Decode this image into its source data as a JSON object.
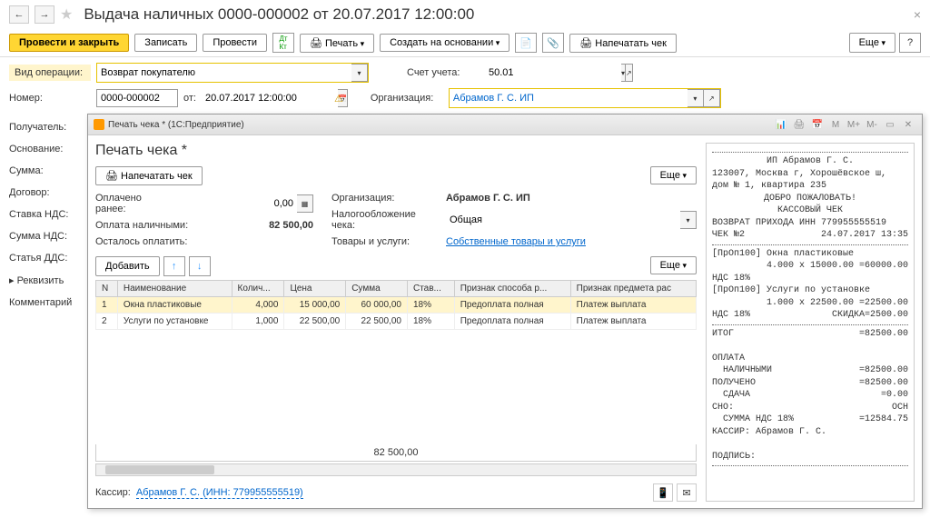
{
  "title": "Выдача наличных 0000-000002 от 20.07.2017 12:00:00",
  "toolbar": {
    "conduct_close": "Провести и закрыть",
    "save": "Записать",
    "conduct": "Провести",
    "print": "Печать",
    "create_based": "Создать на основании",
    "print_check": "Напечатать чек",
    "more": "Еще"
  },
  "form": {
    "op_type_label": "Вид операции:",
    "op_type_value": "Возврат покупателю",
    "account_label": "Счет учета:",
    "account_value": "50.01",
    "number_label": "Номер:",
    "number_value": "0000-000002",
    "from_label": "от:",
    "date_value": "20.07.2017 12:00:00",
    "org_label": "Организация:",
    "org_value": "Абрамов Г. С. ИП"
  },
  "sidebar": {
    "recipient": "Получатель:",
    "basis": "Основание:",
    "sum": "Сумма:",
    "contract": "Договор:",
    "vat_rate": "Ставка НДС:",
    "vat_sum": "Сумма НДС:",
    "dds": "Статья ДДС:",
    "requisites": "Реквизить",
    "comment": "Комментарий"
  },
  "dialog": {
    "window_title": "Печать чека * (1С:Предприятие)",
    "header": "Печать чека *",
    "print_btn": "Напечатать чек",
    "more": "Еще",
    "paid_before_label": "Оплачено ранее:",
    "paid_before_value": "0,00",
    "cash_pay_label": "Оплата наличными:",
    "cash_pay_value": "82 500,00",
    "remaining_label": "Осталось оплатить:",
    "org_label": "Организация:",
    "org_value": "Абрамов Г. С. ИП",
    "tax_label": "Налогообложение чека:",
    "tax_value": "Общая",
    "goods_label": "Товары и услуги:",
    "goods_link": "Собственные товары и услуги",
    "add_btn": "Добавить",
    "table": {
      "cols": [
        "N",
        "Наименование",
        "Колич...",
        "Цена",
        "Сумма",
        "Став...",
        "Признак способа р...",
        "Признак предмета рас"
      ],
      "rows": [
        {
          "n": "1",
          "name": "Окна пластиковые",
          "qty": "4,000",
          "price": "15 000,00",
          "sum": "60 000,00",
          "vat": "18%",
          "sign1": "Предоплата полная",
          "sign2": "Платеж выплата"
        },
        {
          "n": "2",
          "name": "Услуги по установке",
          "qty": "1,000",
          "price": "22 500,00",
          "sum": "22 500,00",
          "vat": "18%",
          "sign1": "Предоплата полная",
          "sign2": "Платеж выплата"
        }
      ],
      "total": "82 500,00"
    },
    "cashier_label": "Кассир:",
    "cashier_value": "Абрамов Г. С. (ИНН: 779955555519)"
  },
  "receipt": {
    "l1": "ИП Абрамов Г. С.",
    "l2": "123007, Москва г, Хорошёвское ш,",
    "l3": "дом № 1, квартира 235",
    "l4": "ДОБРО ПОЖАЛОВАТЬ!",
    "l5": "КАССОВЫЙ ЧЕК",
    "l6": "ВОЗВРАТ ПРИХОДА ИНН 779955555519",
    "l7a": "ЧЕК №2",
    "l7b": "24.07.2017 13:35",
    "l8": "[ПрОп100] Окна пластиковые",
    "l9": "4.000 х 15000.00 =60000.00",
    "l10": "НДС 18%",
    "l11": "[ПрОп100] Услуги по установке",
    "l12": "1.000 х  22500.00 =22500.00",
    "l13a": "НДС 18%",
    "l13b": "СКИДКА=2500.00",
    "l14a": "ИТОГ",
    "l14b": "=82500.00",
    "l15": "ОПЛАТА",
    "l16a": "НАЛИЧНЫМИ",
    "l16b": "=82500.00",
    "l17a": "ПОЛУЧЕНО",
    "l17b": "=82500.00",
    "l18a": "СДАЧА",
    "l18b": "=0.00",
    "l19a": "СНО:",
    "l19b": "ОСН",
    "l20a": "СУММА НДС 18%",
    "l20b": "=12584.75",
    "l21": "КАССИР: Абрамов Г. С.",
    "l22": "ПОДПИСЬ:"
  }
}
